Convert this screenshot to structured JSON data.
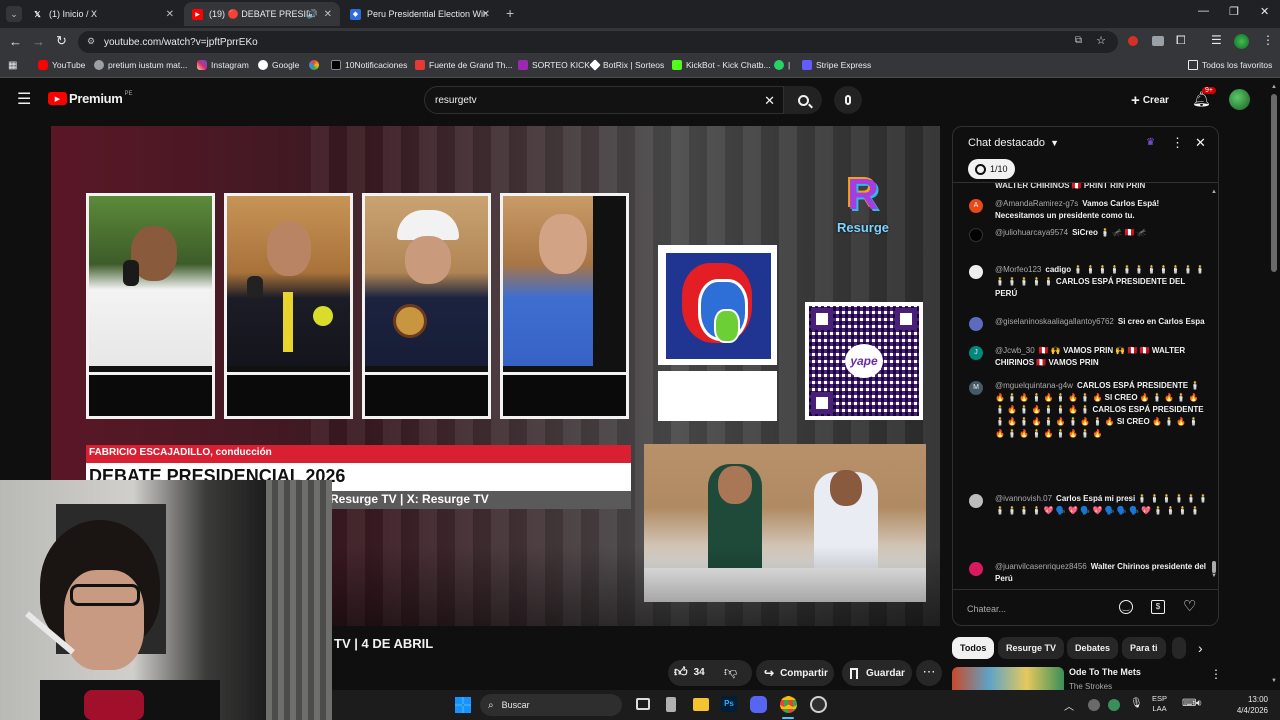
{
  "browser": {
    "tabs": [
      {
        "title": "(1) Inicio / X",
        "icon": "x-logo-icon"
      },
      {
        "title": "(19) 🔴 DEBATE PRESIDENC",
        "icon": "youtube-icon"
      },
      {
        "title": "Peru Presidential Election Winn",
        "icon": "polymarket-icon"
      }
    ],
    "url": "youtube.com/watch?v=jpftPprrEKo",
    "bookmarks": [
      {
        "label": "YouTube",
        "color": "#ff0000"
      },
      {
        "label": "pretium iustum mat...",
        "color": "#9aa0a6"
      },
      {
        "label": "Instagram",
        "color": "#e1306c"
      },
      {
        "label": "Google",
        "color": "#ffffff"
      },
      {
        "label": "",
        "color": "#34a853"
      },
      {
        "label": "10Notificaciones",
        "color": "#000000"
      },
      {
        "label": "Fuente de Grand Th...",
        "color": "#e53935"
      },
      {
        "label": "SORTEO KICK",
        "color": "#9c27b0"
      },
      {
        "label": "BotRix | Sorteos",
        "color": "#ffffff"
      },
      {
        "label": "KickBot - Kick Chatb...",
        "color": "#53fc18"
      },
      {
        "label": "|",
        "color": "#25d366"
      },
      {
        "label": "Stripe Express",
        "color": "#635bff"
      }
    ],
    "all_favorites": "Todos los favoritos"
  },
  "youtube": {
    "logo": "Premium",
    "country": "PE",
    "search_value": "resurgetv",
    "create_label": "Crear",
    "notifications_badge": "9+",
    "video_bottom_title": "TV | 4 DE ABRIL",
    "likes": "34",
    "share_label": "Compartir",
    "save_label": "Guardar"
  },
  "overlay": {
    "brand": "Resurge",
    "brand_letter": "R",
    "host_line": "FABRICIO ESCAJADILLO, conducción",
    "debate_title": "DEBATE PRESIDENCIAL 2026",
    "social": "Resurge TV | X: Resurge TV",
    "yape": "yape"
  },
  "chat": {
    "title": "Chat destacado",
    "counter": "1/10",
    "partial_top": "WALTER CHIRINOS 🇵🇪 PRINT RIN PRIN",
    "messages": [
      {
        "author": "@AmandaRamirez-g7s",
        "text": "Vamos Carlos Espá! Necesitamos un presidente como tu.",
        "avatar_color": "#e64a19",
        "avatar_letter": "A"
      },
      {
        "author": "@juliohuarcaya9574",
        "text": "SiCreo 🕯️ 🦟 🇵🇪 🦟",
        "avatar_color": "#000000",
        "avatar_letter": ""
      },
      {
        "author": "@Morfeo123",
        "text": "cadigo 🕯️ 🕯️ 🕯️ 🕯️ 🕯️ 🕯️ 🕯️ 🕯️ 🕯️ 🕯️ 🕯️ 🕯️ 🕯️ 🕯️ 🕯️ 🕯️ CARLOS ESPÁ PRESIDENTE DEL PERÚ",
        "avatar_color": "#eeeeee",
        "avatar_letter": ""
      },
      {
        "author": "@giselaninoskaaliagallantoy6762",
        "text": "Si creo en Carlos Espa",
        "avatar_color": "#5c6bc0",
        "avatar_letter": ""
      },
      {
        "author": "@Jcwb_30",
        "text": "🇵🇪 🙌 VAMOS PRIN 🙌 🇵🇪 🇵🇪 WALTER CHIRINOS 🇵🇪 VAMOS PRIN",
        "avatar_color": "#00897b",
        "avatar_letter": "J"
      },
      {
        "author": "@mguelquintana-g4w",
        "text": "CARLOS ESPÁ PRESIDENTE 🕯️ 🔥 🕯️ 🔥 🕯️ 🔥 🕯️ 🔥 🕯️ 🔥 SI CREO 🔥 🕯️ 🔥 🕯️ 🔥 🕯️ 🔥 🕯️ 🔥 🕯️ 🕯️ 🔥 🕯️ CARLOS ESPÁ PRESIDENTE 🕯️ 🔥 🕯️ 🔥 🕯️ 🔥 🕯️ 🔥 🕯️ 🔥 SI CREO 🔥 🕯️ 🔥 🕯️ 🔥 🕯️ 🔥 🕯️ 🔥 🕯️ 🔥 🕯️ 🔥",
        "avatar_color": "#455a64",
        "avatar_letter": "M"
      },
      {
        "author": "@ivannovish.07",
        "text": "Carlos Espá mi presi 🕯️ 🕯️ 🕯️ 🕯️ 🕯️ 🕯️ 🕯️ 🕯️ 🕯️ 🕯️ 💖 🗣️ 💖 🗣️ 💖 🗣️ 🗣️ 🗣️ 💖 🕯️ 🕯️ 🕯️ 🕯️",
        "avatar_color": "#bdbdbd",
        "avatar_letter": ""
      },
      {
        "author": "@juanvilcasenriquez8456",
        "text": "Walter Chirinos presidente del Perú",
        "avatar_color": "#d81b60",
        "avatar_letter": ""
      }
    ],
    "input_placeholder": "Chatear..."
  },
  "related": {
    "chips": [
      "Todos",
      "Resurge TV",
      "Debates",
      "Para ti"
    ],
    "first_title": "Ode To The Mets",
    "first_channel": "The Strokes"
  },
  "taskbar": {
    "search_placeholder": "Buscar",
    "lang": "ESP",
    "lang_sub": "LAA",
    "time": "13:00",
    "date": "4/4/2026"
  }
}
